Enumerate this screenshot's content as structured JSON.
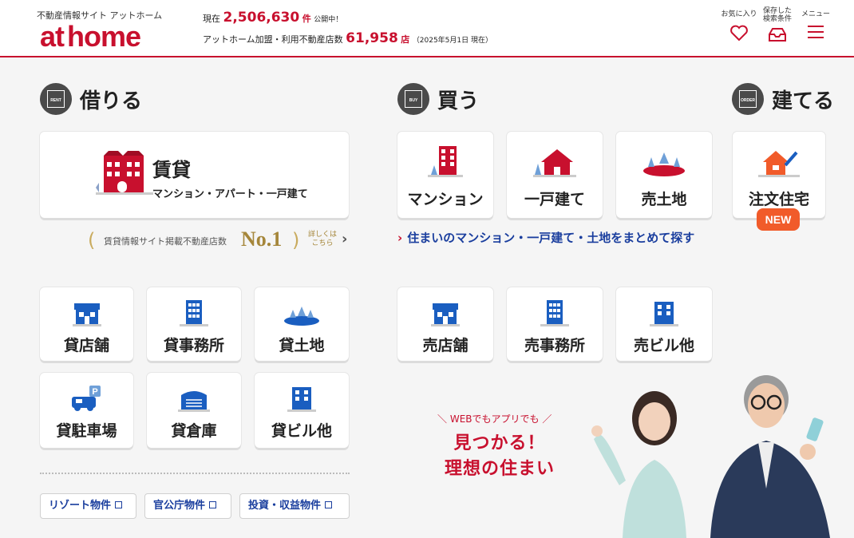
{
  "header": {
    "site_name": "不動産情報サイト アットホーム",
    "logo": "at home",
    "listing_prefix": "現在",
    "listing_count": "2,506,630",
    "listing_unit": "件",
    "listing_suffix": "公開中！",
    "stores_prefix": "アットホーム加盟・利用不動産店数",
    "stores_count": "61,958",
    "stores_unit": "店",
    "stores_date": "（2025年5月1日 現在）",
    "favorites_label": "お気に入り",
    "saved_label_1": "保存した",
    "saved_label_2": "検索条件",
    "menu_label": "メニュー"
  },
  "rent": {
    "icon_text": "RENT",
    "title": "借りる",
    "main_title": "賃貸",
    "main_sub": "マンション・アパート・一戸建て",
    "no1_text": "賃貸情報サイト掲載不動産店数",
    "no1_big": "No.1",
    "no1_more_1": "詳しくは",
    "no1_more_2": "こちら",
    "tiles": [
      {
        "label": "貸店舗",
        "icon": "store-icon"
      },
      {
        "label": "貸事務所",
        "icon": "office-building-icon"
      },
      {
        "label": "貸土地",
        "icon": "land-icon"
      },
      {
        "label": "貸駐車場",
        "icon": "parking-icon"
      },
      {
        "label": "貸倉庫",
        "icon": "warehouse-icon"
      },
      {
        "label": "貸ビル他",
        "icon": "building-icon"
      }
    ],
    "links": [
      "リゾート物件",
      "官公庁物件",
      "投資・収益物件"
    ]
  },
  "buy": {
    "icon_text": "BUY",
    "title": "買う",
    "tiles": [
      {
        "label": "マンション",
        "icon": "condo-icon"
      },
      {
        "label": "一戸建て",
        "icon": "house-icon"
      },
      {
        "label": "売土地",
        "icon": "land-icon"
      }
    ],
    "link": "住まいのマンション・一戸建て・土地をまとめて探す",
    "tiles2": [
      {
        "label": "売店舗",
        "icon": "store-icon"
      },
      {
        "label": "売事務所",
        "icon": "office-building-icon"
      },
      {
        "label": "売ビル他",
        "icon": "building-icon"
      }
    ]
  },
  "build": {
    "icon_text": "ORDER",
    "title": "建てる",
    "tile": "注文住宅",
    "badge": "NEW"
  },
  "promo": {
    "small": "WEBでもアプリでも",
    "line1": "見つかる！",
    "line2": "理想の住まい"
  },
  "colors": {
    "brand": "#c8102e",
    "blue": "#1a3e9e",
    "new": "#f15b2a"
  }
}
